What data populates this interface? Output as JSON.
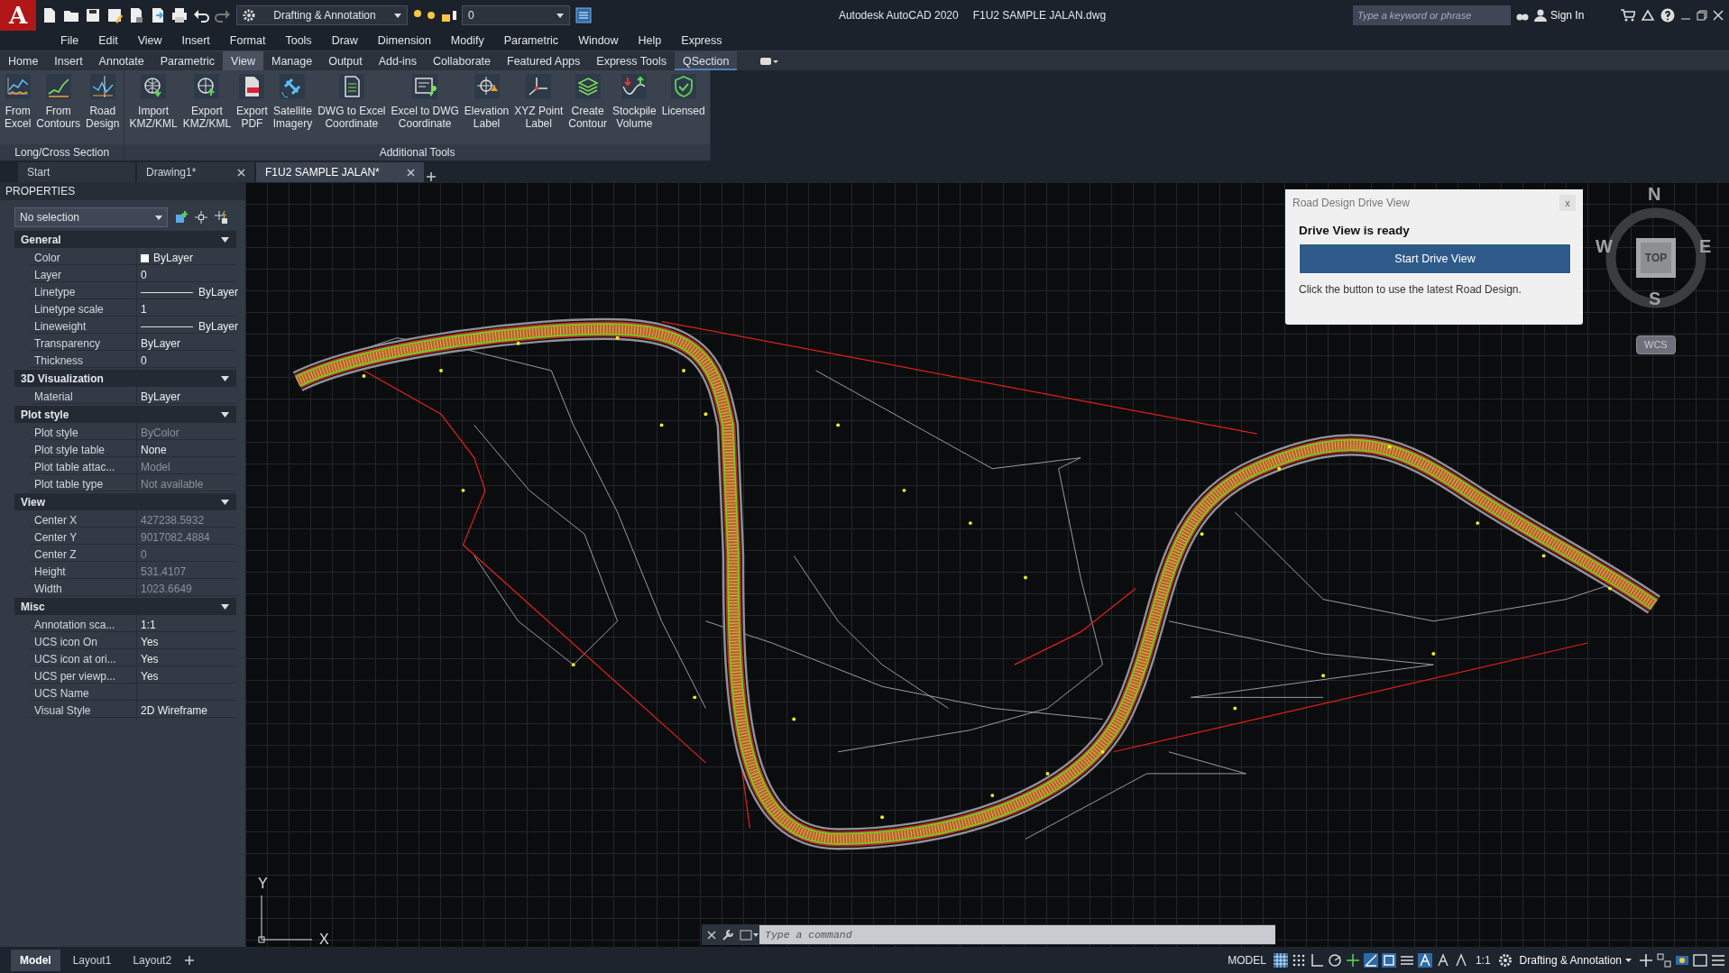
{
  "app": {
    "logo_letter": "A",
    "workspace": "Drafting & Annotation",
    "layer": "0",
    "title": "Autodesk AutoCAD 2020",
    "file_name": "F1U2 SAMPLE JALAN.dwg",
    "search": {
      "placeholder": "Type a keyword or phrase"
    },
    "sign_in": "Sign In"
  },
  "menu": [
    "File",
    "Edit",
    "View",
    "Insert",
    "Format",
    "Tools",
    "Draw",
    "Dimension",
    "Modify",
    "Parametric",
    "Window",
    "Help",
    "Express"
  ],
  "ribbon_tabs": [
    {
      "label": "Home",
      "selected": false
    },
    {
      "label": "Insert",
      "selected": false
    },
    {
      "label": "Annotate",
      "selected": false
    },
    {
      "label": "Parametric",
      "selected": false
    },
    {
      "label": "View",
      "selected": false,
      "highlighted": true
    },
    {
      "label": "Manage",
      "selected": false
    },
    {
      "label": "Output",
      "selected": false
    },
    {
      "label": "Add-ins",
      "selected": false
    },
    {
      "label": "Collaborate",
      "selected": false
    },
    {
      "label": "Featured Apps",
      "selected": false
    },
    {
      "label": "Express Tools",
      "selected": false
    },
    {
      "label": "QSection",
      "selected": true
    }
  ],
  "ribbon_panels": [
    {
      "title": "Long/Cross Section",
      "buttons": [
        {
          "kind": "chart",
          "lines": [
            "From",
            "Excel"
          ]
        },
        {
          "kind": "contour",
          "lines": [
            "From",
            "Contours"
          ]
        },
        {
          "kind": "xs",
          "lines": [
            "Road",
            "Design"
          ]
        }
      ]
    },
    {
      "title": "Additional Tools",
      "buttons": [
        {
          "kind": "globe-down",
          "lines": [
            "Import",
            "KMZ/KML"
          ]
        },
        {
          "kind": "globe-up",
          "lines": [
            "Export",
            "KMZ/KML"
          ]
        },
        {
          "kind": "pdf",
          "lines": [
            "Export",
            "PDF"
          ]
        },
        {
          "kind": "satellite",
          "lines": [
            "Satellite",
            "Imagery"
          ]
        },
        {
          "kind": "doc",
          "lines": [
            "DWG to Excel",
            "Coordinate"
          ]
        },
        {
          "kind": "doc-pin",
          "lines": [
            "Excel to DWG",
            "Coordinate"
          ]
        },
        {
          "kind": "target",
          "lines": [
            "Elevation",
            "Label"
          ]
        },
        {
          "kind": "axes",
          "lines": [
            "XYZ Point",
            "Label"
          ]
        },
        {
          "kind": "layers",
          "lines": [
            "Create",
            "Contour"
          ]
        },
        {
          "kind": "volume",
          "lines": [
            "Stockpile",
            "Volume"
          ]
        },
        {
          "kind": "shield",
          "lines": [
            "Licensed"
          ]
        }
      ]
    }
  ],
  "doc_tabs": [
    {
      "label": "Start",
      "selected": false,
      "closable": false
    },
    {
      "label": "Drawing1*",
      "selected": false,
      "closable": true
    },
    {
      "label": "F1U2 SAMPLE JALAN*",
      "selected": true,
      "closable": true
    }
  ],
  "properties": {
    "title": "PROPERTIES",
    "selection": "No selection",
    "sections": [
      {
        "title": "General",
        "expanded": true,
        "rows": [
          {
            "label": "Color",
            "value": "ByLayer",
            "kind": "color",
            "dim": false
          },
          {
            "label": "Layer",
            "value": "0",
            "kind": "text",
            "dim": false
          },
          {
            "label": "Linetype",
            "value": "ByLayer",
            "kind": "line",
            "dim": false
          },
          {
            "label": "Linetype scale",
            "value": "1",
            "kind": "text",
            "dim": false
          },
          {
            "label": "Lineweight",
            "value": "ByLayer",
            "kind": "line",
            "dim": false
          },
          {
            "label": "Transparency",
            "value": "ByLayer",
            "kind": "text",
            "dim": false
          },
          {
            "label": "Thickness",
            "value": "0",
            "kind": "text",
            "dim": false
          }
        ]
      },
      {
        "title": "3D Visualization",
        "expanded": true,
        "rows": [
          {
            "label": "Material",
            "value": "ByLayer",
            "kind": "text",
            "dim": false
          }
        ]
      },
      {
        "title": "Plot style",
        "expanded": true,
        "rows": [
          {
            "label": "Plot style",
            "value": "ByColor",
            "kind": "text",
            "dim": true
          },
          {
            "label": "Plot style table",
            "value": "None",
            "kind": "text",
            "dim": false
          },
          {
            "label": "Plot table attac...",
            "value": "Model",
            "kind": "text",
            "dim": true
          },
          {
            "label": "Plot table type",
            "value": "Not available",
            "kind": "text",
            "dim": true
          }
        ]
      },
      {
        "title": "View",
        "expanded": true,
        "rows": [
          {
            "label": "Center X",
            "value": "427238.5932",
            "kind": "text",
            "dim": true
          },
          {
            "label": "Center Y",
            "value": "9017082.4884",
            "kind": "text",
            "dim": true
          },
          {
            "label": "Center Z",
            "value": "0",
            "kind": "text",
            "dim": true
          },
          {
            "label": "Height",
            "value": "531.4107",
            "kind": "text",
            "dim": true
          },
          {
            "label": "Width",
            "value": "1023.6649",
            "kind": "text",
            "dim": true
          }
        ]
      },
      {
        "title": "Misc",
        "expanded": true,
        "rows": [
          {
            "label": "Annotation sca...",
            "value": "1:1",
            "kind": "text",
            "dim": false
          },
          {
            "label": "UCS icon On",
            "value": "Yes",
            "kind": "text",
            "dim": false
          },
          {
            "label": "UCS icon at ori...",
            "value": "Yes",
            "kind": "text",
            "dim": false
          },
          {
            "label": "UCS per viewp...",
            "value": "Yes",
            "kind": "text",
            "dim": false
          },
          {
            "label": "UCS Name",
            "kind": "text",
            "dim": false
          },
          {
            "label": "Visual Style",
            "value": "2D Wireframe",
            "kind": "text",
            "dim": false
          }
        ]
      }
    ]
  },
  "drive_view": {
    "title": "Road Design Drive View",
    "close_label": "x",
    "heading": "Drive View is ready",
    "button": "Start Drive View",
    "message": "Click the button to use the latest Road Design."
  },
  "viewcube": {
    "north": "N",
    "south": "S",
    "east": "E",
    "west": "W",
    "face": "TOP",
    "coords": "WCS"
  },
  "ucs": {
    "x": "X",
    "y": "Y"
  },
  "command": {
    "placeholder": "Type a command"
  },
  "layout_tabs": [
    {
      "label": "Model",
      "selected": true
    },
    {
      "label": "Layout1",
      "selected": false
    },
    {
      "label": "Layout2",
      "selected": false
    }
  ],
  "status": {
    "space": "MODEL",
    "scale": "1:1",
    "workspace": "Drafting & Annotation"
  }
}
